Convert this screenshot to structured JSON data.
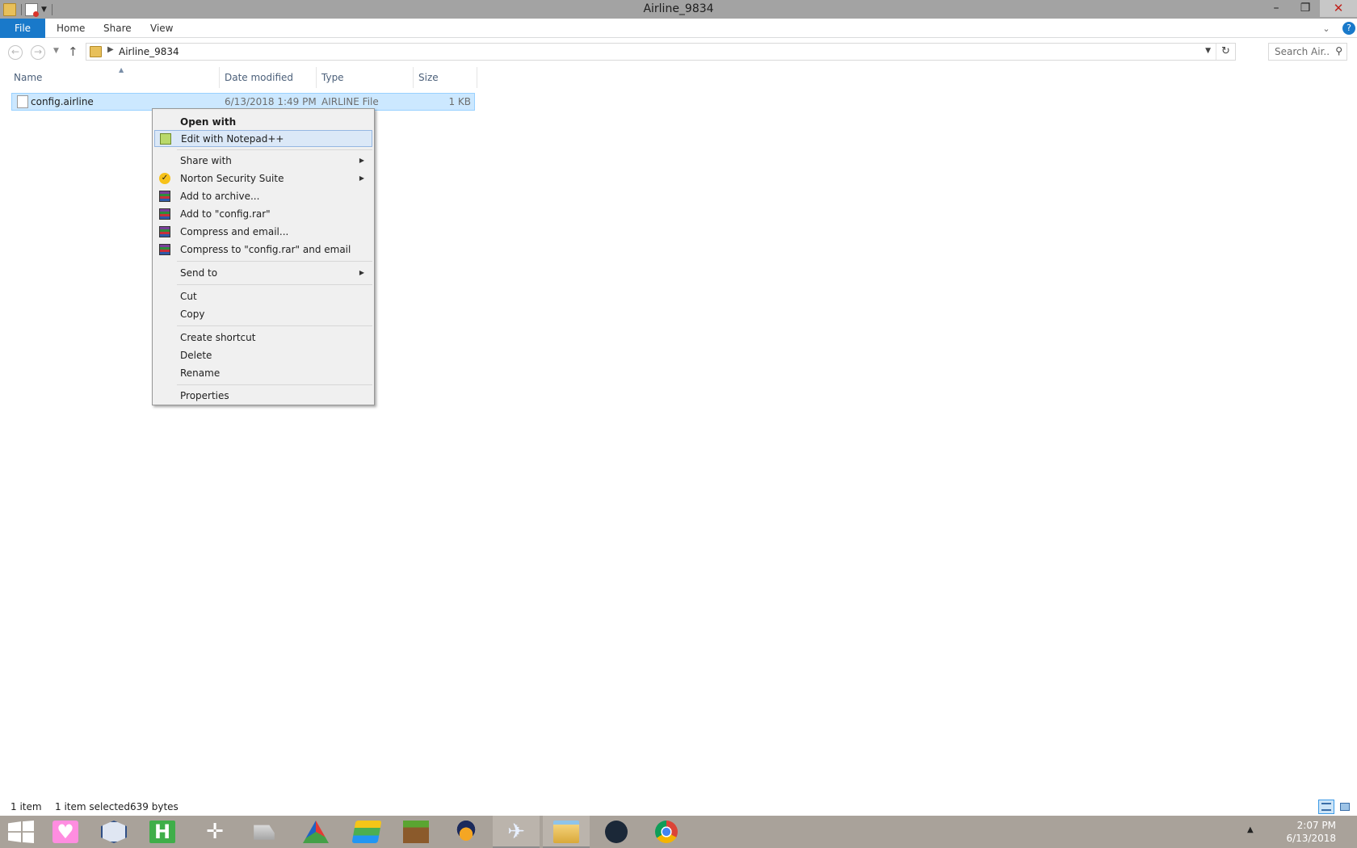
{
  "window": {
    "title": "Airline_9834"
  },
  "ribbon": {
    "tabs": [
      "File",
      "Home",
      "Share",
      "View"
    ]
  },
  "address": {
    "crumb": "Airline_9834",
    "search_placeholder": "Search Air..."
  },
  "columns": {
    "name": "Name",
    "date": "Date modified",
    "type": "Type",
    "size": "Size"
  },
  "files": [
    {
      "name": "config.airline",
      "date": "6/13/2018 1:49 PM",
      "type": "AIRLINE File",
      "size": "1 KB"
    }
  ],
  "context_menu": {
    "items": [
      {
        "label": "Open with",
        "icon": ""
      },
      {
        "label": "Edit with Notepad++",
        "icon": "notepad-plus-plus-icon"
      },
      {
        "label": "Share with",
        "icon": ""
      },
      {
        "label": "Norton Security Suite",
        "icon": "norton-icon"
      },
      {
        "label": "Add to archive...",
        "icon": "winrar-icon"
      },
      {
        "label": "Add to \"config.rar\"",
        "icon": "winrar-icon"
      },
      {
        "label": "Compress and email...",
        "icon": "winrar-icon"
      },
      {
        "label": "Compress to \"config.rar\" and email",
        "icon": "winrar-icon"
      },
      {
        "label": "Send to",
        "icon": ""
      },
      {
        "label": "Cut",
        "icon": ""
      },
      {
        "label": "Copy",
        "icon": ""
      },
      {
        "label": "Create shortcut",
        "icon": ""
      },
      {
        "label": "Delete",
        "icon": ""
      },
      {
        "label": "Rename",
        "icon": ""
      },
      {
        "label": "Properties",
        "icon": ""
      }
    ]
  },
  "status": {
    "count": "1 item",
    "selected": "1 item selected",
    "size": "639 bytes"
  },
  "taskbar": {
    "apps": [
      "start-icon",
      "heart-app-icon",
      "virtualbox-icon",
      "h-app-icon",
      "crosshair-icon",
      "trucker-icon",
      "rgb-app-icon",
      "bluestacks-icon",
      "minecraft-icon",
      "audacity-icon",
      "airline-app-icon",
      "file-explorer-icon",
      "steam-icon",
      "chrome-icon"
    ],
    "time": "2:07 PM",
    "date": "6/13/2018"
  },
  "colors": {
    "selection": "#cce8ff",
    "file_tab": "#1979ca",
    "taskbar": "#a9a29a",
    "menu_bg": "#f0f0f0"
  }
}
